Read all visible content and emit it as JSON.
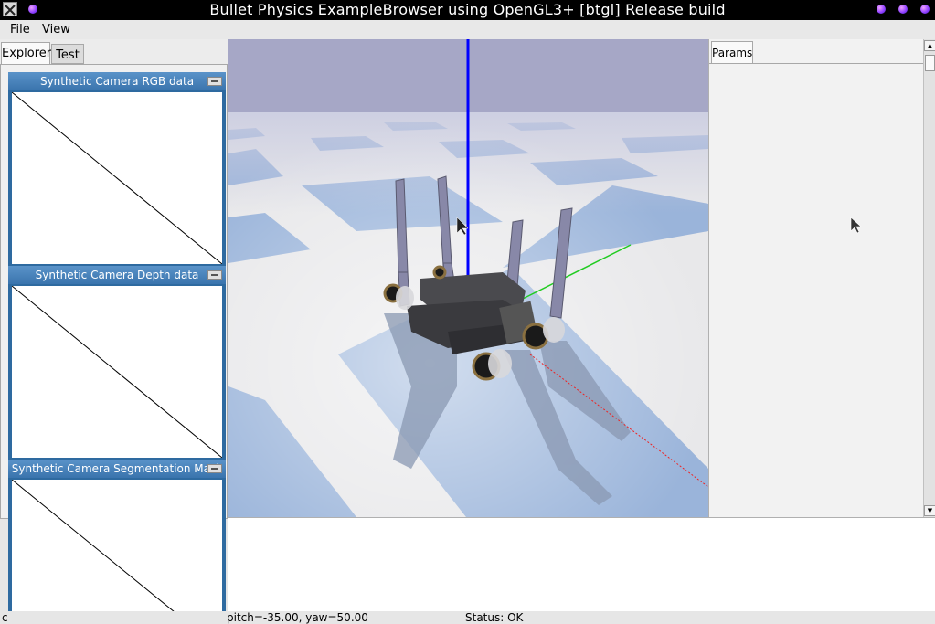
{
  "window": {
    "title": "Bullet Physics ExampleBrowser using OpenGL3+ [btgl] Release build"
  },
  "menu": {
    "items": [
      "File",
      "View"
    ]
  },
  "explorer": {
    "tabs": [
      {
        "label": "Explorer",
        "active": true
      },
      {
        "label": "Test",
        "active": false
      }
    ]
  },
  "camera_panels": [
    {
      "title": "Synthetic Camera RGB data"
    },
    {
      "title": "Synthetic Camera Depth data"
    },
    {
      "title": "Synthetic Camera Segmentation Mask"
    }
  ],
  "params": {
    "tab_label": "Params"
  },
  "status": {
    "left": "c",
    "camera": "pitch=-35.00, yaw=50.00",
    "state": "Status: OK"
  },
  "colors": {
    "sky": "#a6a7c6",
    "floor_light": "#e8e8ea",
    "floor_blue": "#9ab4da",
    "panel_header": "#4a84bd",
    "axis_blue": "#0000ff",
    "axis_green": "#22cc22",
    "axis_red": "#ee2222"
  },
  "icons": {
    "app": "x-window-icon",
    "title_dots": "purple-dot-icon",
    "panel_min": "minimize-icon",
    "cursor": "mouse-cursor-icon"
  }
}
